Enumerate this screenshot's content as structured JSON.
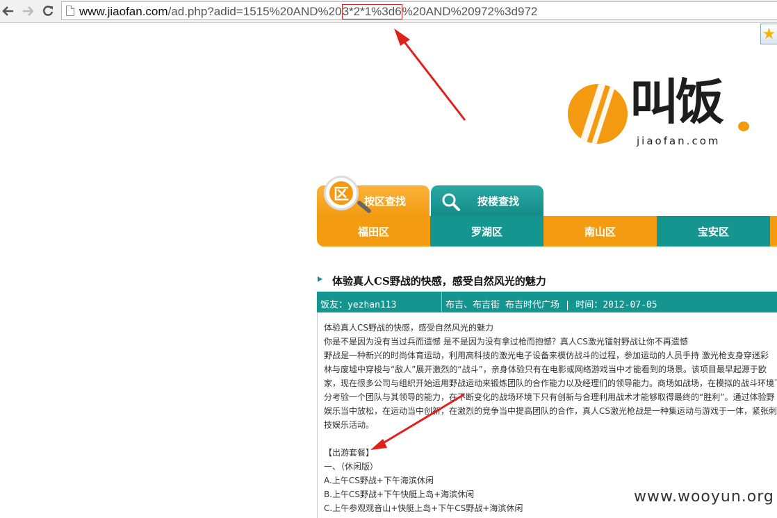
{
  "browser": {
    "url_host": "www.jiaofan.com",
    "url_path_before": "/ad.php?adid=1515%20AND%20",
    "url_highlight": "3*2*1%3d6",
    "url_path_after": "%20AND%20972%3d972"
  },
  "logo": {
    "chars": "叫饭",
    "domain": "jiaofan.com"
  },
  "tabs": {
    "badge_char": "区",
    "district_search": "按区查找",
    "building_search": "按楼查找"
  },
  "districts": [
    "福田区",
    "罗湖区",
    "南山区",
    "宝安区"
  ],
  "article": {
    "title": "体验真人CS野战的快感，感受自然风光的魅力",
    "user": "饭友：yezhan113",
    "location_time": "布吉、布吉街 布吉时代广场 | 时间：2012-07-05",
    "lines": [
      "体验真人CS野战的快感，感受自然风光的魅力",
      "    你是不是因为没有当过兵而遗憾 是不是因为没有拿过枪而抱憾？真人CS激光镭射野战让你不再遗憾",
      "    野战是一种新兴的时尚体育运动，利用高科技的激光电子设备来模仿战斗的过程，参加运动的人员手持 激光枪支身穿迷彩",
      "林与废墟中穿梭与“敌人”展开激烈的“战斗”，亲身体验只有在电影或网络游戏当中才能看到的场景。该项目最早起源于欧",
      "家，现在很多公司与组织开始运用野战运动来锻炼团队的合作能力以及经理们的领导能力。商场如战场，在模拟的战斗环境下",
      "分考验一个团队与其领导的能力，在不断变化的战场环境下只有创新与合理利用战术才能够取得最终的“胜利”。通过体验野",
      "娱乐当中放松，在运动当中创新，在激烈的竞争当中提高团队的合作，真人CS激光枪战是一种集运动与游戏于一体，紧张刺激",
      "技娱乐活动。",
      "",
      "【出游套餐】",
      "一、（休闲版）",
      "        A.上午CS野战+下午海滨休闲",
      "        B.上午CS野战+下午快艇上岛+海滨休闲",
      "    C.上午参观观音山+快艇上岛+下午CS野战+海滨休闲"
    ]
  },
  "watermark": "www.wooyun.org",
  "colors": {
    "orange": "#f39c12",
    "teal": "#14958f",
    "annotation_red": "#e0201a"
  },
  "icons": [
    "back-arrow-icon",
    "forward-arrow-icon",
    "reload-icon",
    "page-icon",
    "star-icon",
    "magnifier-icon"
  ]
}
